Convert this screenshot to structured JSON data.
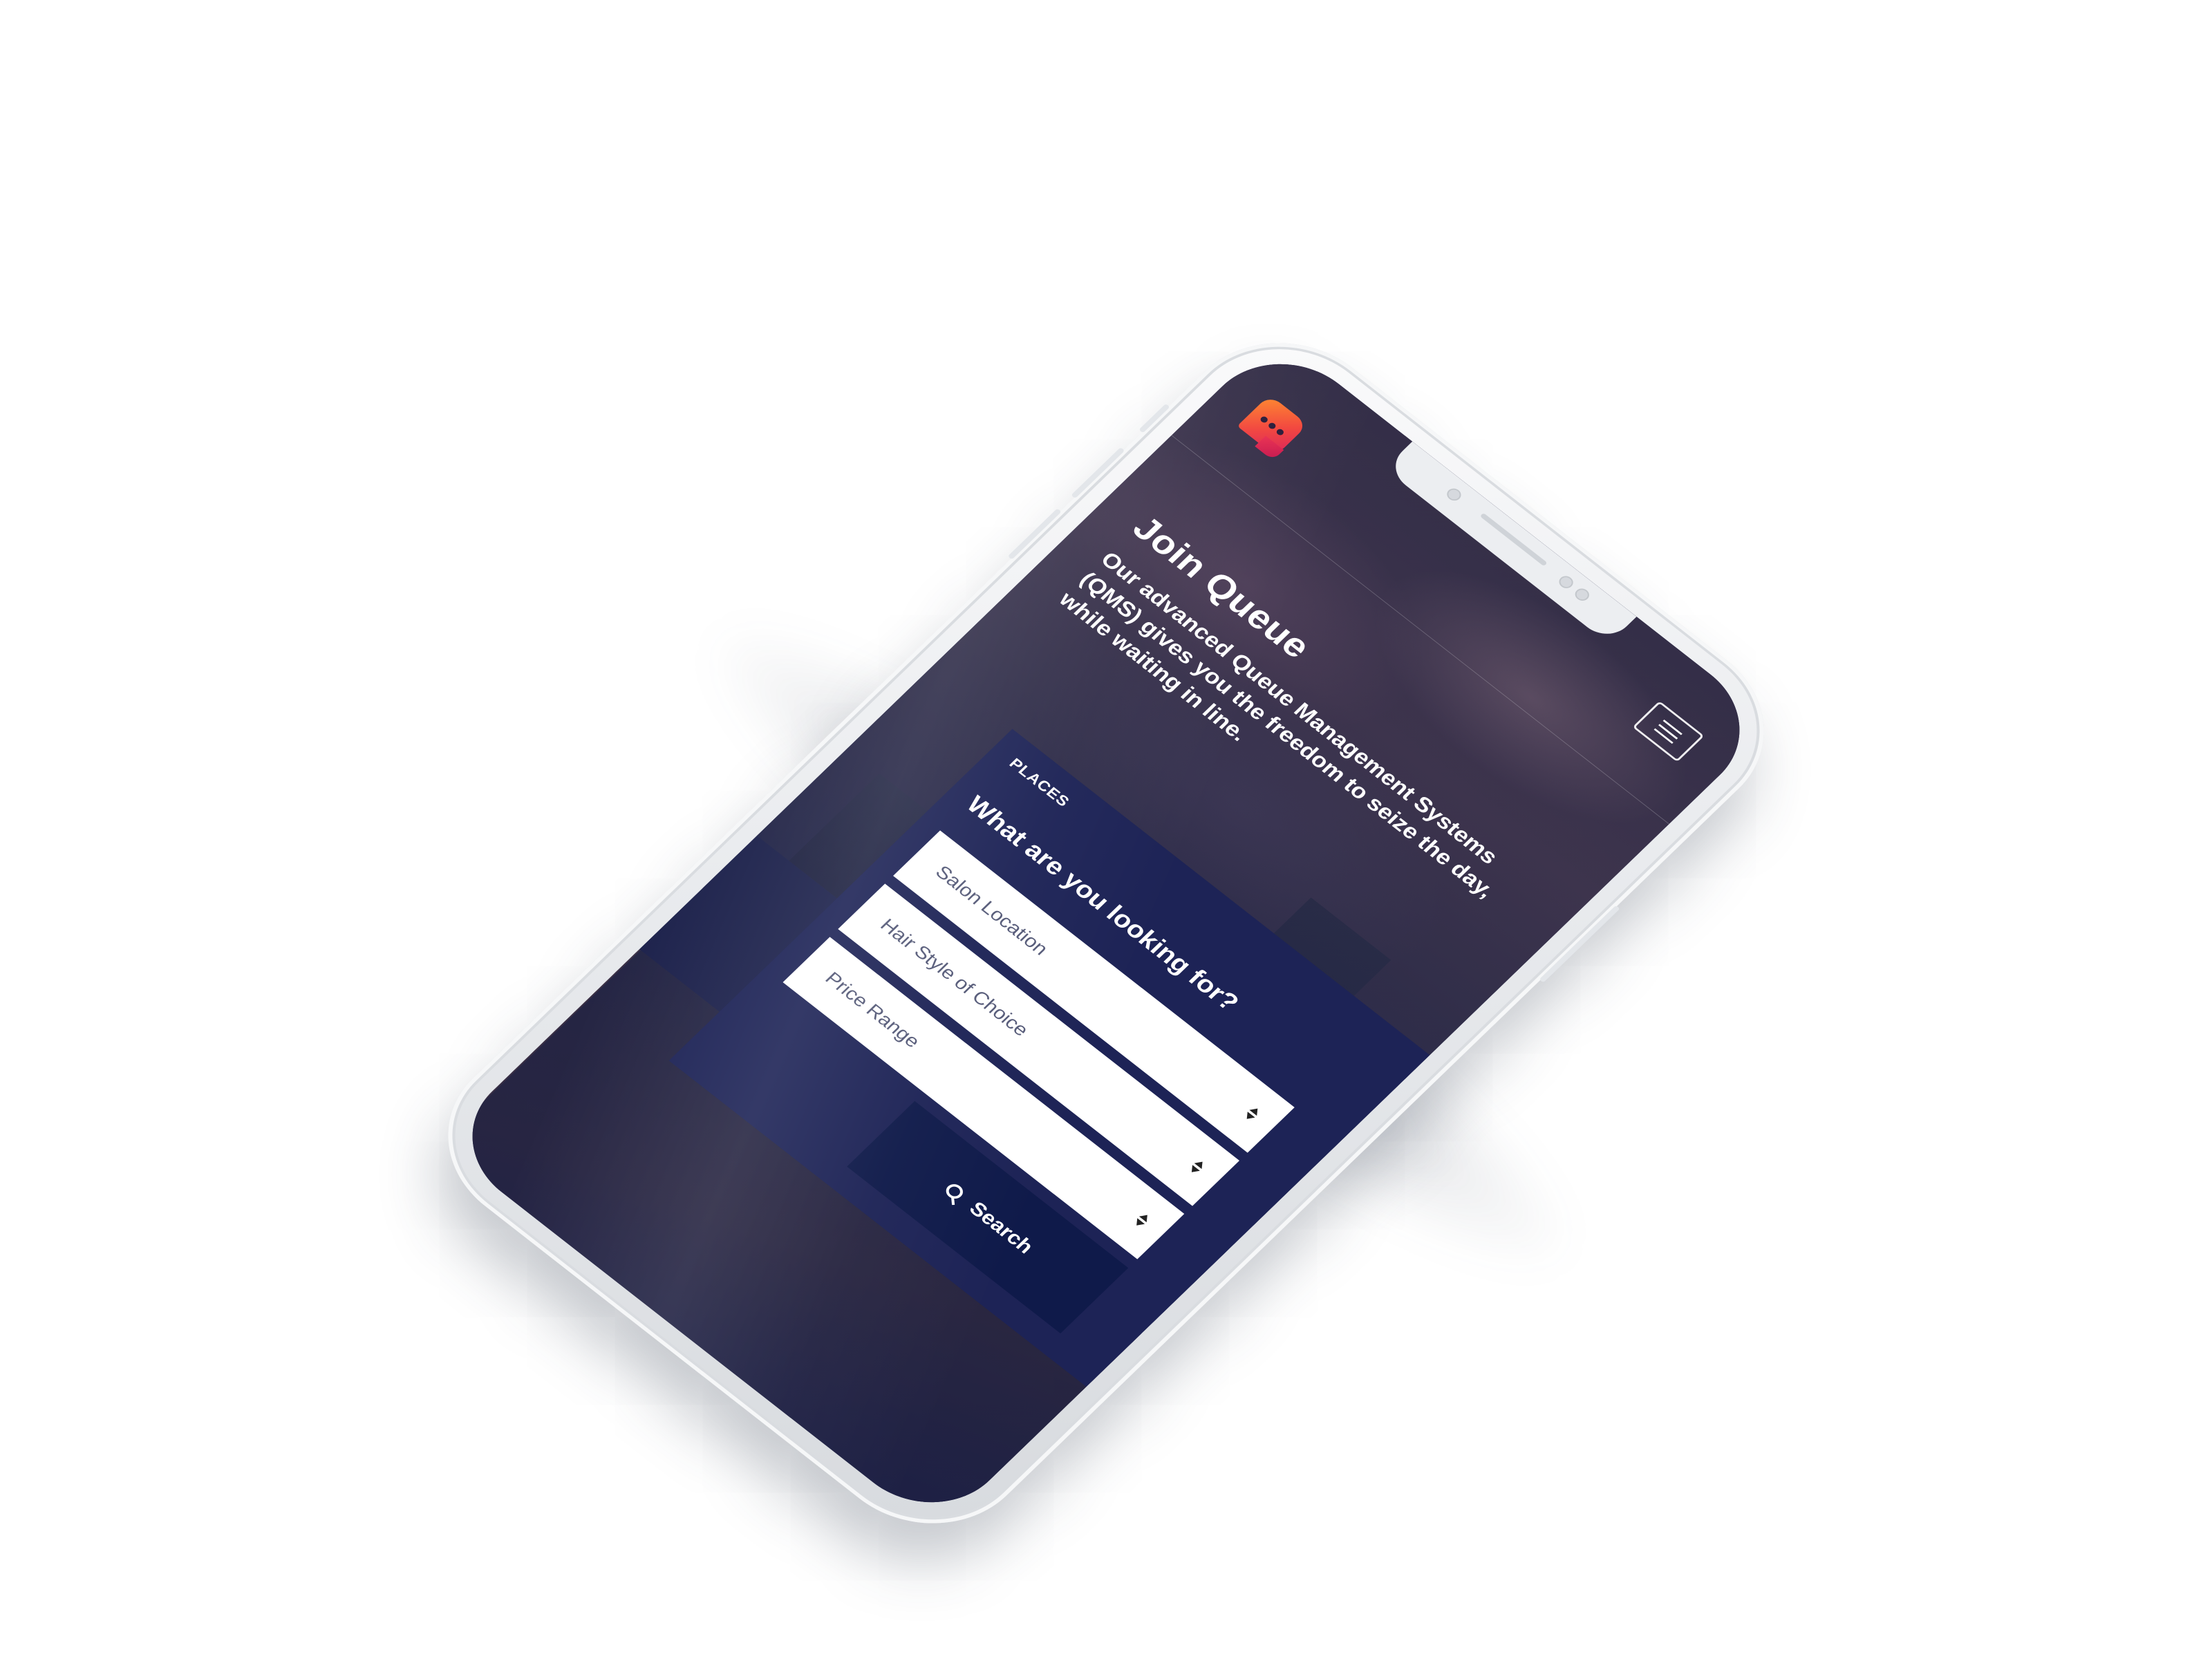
{
  "header": {
    "logo_icon": "chat-bubble-icon",
    "menu_icon": "hamburger-menu-icon"
  },
  "hero": {
    "title": "Join Queue",
    "description": "Our advanced Queue Management Systems (QMS) gives you the freedom to seize the day, while waiting in line."
  },
  "search_panel": {
    "tab_label": "PLACES",
    "title": "What are you looking for?",
    "fields": [
      {
        "label": "Salon Location"
      },
      {
        "label": "Hair Style of Choice"
      },
      {
        "label": "Price Range"
      }
    ],
    "search_label": "Search",
    "search_icon": "search-icon"
  },
  "colors": {
    "panel_bg": "#1d2356",
    "search_button_bg": "#0f1a4a",
    "logo_gradient_start": "#ff8a2b",
    "logo_gradient_end": "#d9215a",
    "device_body": "#eceef1"
  }
}
